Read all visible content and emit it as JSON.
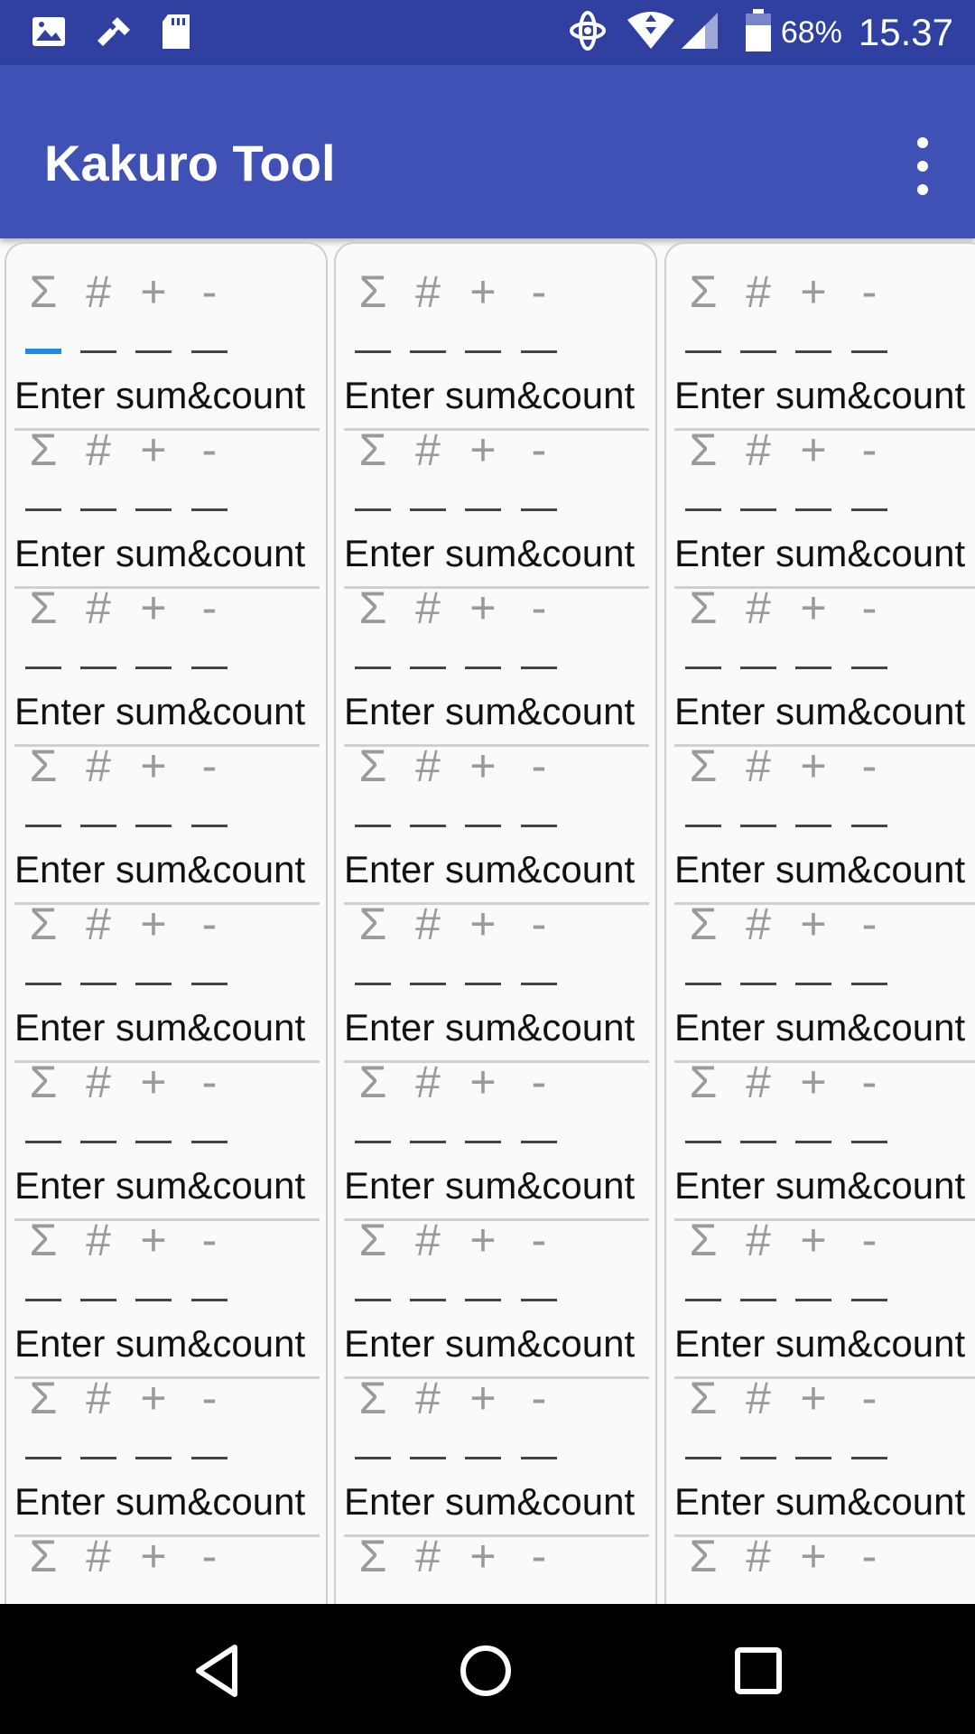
{
  "status_bar": {
    "left_icons": [
      "image-icon",
      "tool-icon",
      "sd-card-icon"
    ],
    "right_icons": [
      "data-sync-icon",
      "wifi-icon",
      "signal-icon",
      "battery-icon"
    ],
    "battery": "68%",
    "time": "15.37"
  },
  "app_bar": {
    "title": "Kakuro Tool",
    "menu_icon": "more-vert-icon"
  },
  "grid": {
    "symbols": {
      "sum": "Σ",
      "count": "#",
      "include": "+",
      "exclude": "-"
    },
    "placeholder": "Enter sum&count",
    "columns": 3,
    "rows_per_column": 9,
    "active_field": "column-1-row-1-sum",
    "accent_color": "#1e88e5"
  },
  "colors": {
    "status_bar": "#3040a0",
    "app_bar": "#3f51b5",
    "background": "#fafafa"
  },
  "nav_bar": {
    "buttons": [
      "back-icon",
      "home-icon",
      "recent-apps-icon"
    ]
  }
}
